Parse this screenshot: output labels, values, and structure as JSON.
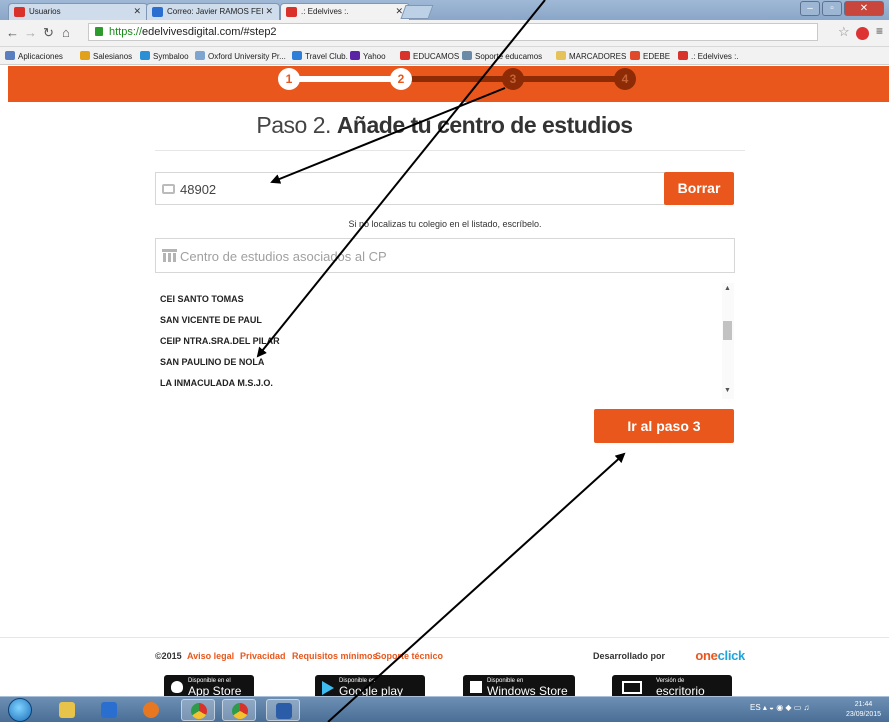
{
  "browser": {
    "tabs": [
      {
        "label": "Usuarios",
        "fav_color": "#d8322a"
      },
      {
        "label": "Correo: Javier RAMOS FEI",
        "fav_color": "#2a6fd0"
      },
      {
        "label": ".: Edelvives :.",
        "fav_color": "#d8322a"
      }
    ],
    "url_scheme": "https://",
    "url_rest": "edelvivesdigital.com/#step2",
    "bookmarks": [
      {
        "label": "Aplicaciones",
        "color": "#5a7fc0"
      },
      {
        "label": "Salesianos",
        "color": "#e2a11a"
      },
      {
        "label": "Symbaloo",
        "color": "#2b8fd6"
      },
      {
        "label": "Oxford University Pr...",
        "color": "#7ea5cf"
      },
      {
        "label": "Travel Club.",
        "color": "#2f7fd8"
      },
      {
        "label": "Yahoo",
        "color": "#5b23a6"
      },
      {
        "label": "EDUCAMOS",
        "color": "#d8322a"
      },
      {
        "label": "Soporte educamos",
        "color": "#6a8aa8"
      },
      {
        "label": "MARCADORES",
        "color": "#e5c25a"
      },
      {
        "label": "EDEBE",
        "color": "#e04a2a"
      },
      {
        "label": ".: Edelvives :.",
        "color": "#d8322a"
      }
    ]
  },
  "steps": {
    "labels": [
      "1",
      "2",
      "3",
      "4"
    ],
    "current": 2,
    "colors": {
      "bar": "#e9571c",
      "dark": "#8c2b06",
      "done": "#ffffff"
    }
  },
  "page": {
    "title_prefix": "Paso 2. ",
    "title_bold": "Añade tu centro de estudios",
    "postal_code_value": "48902",
    "clear_button": "Borrar",
    "hint": "Si no localizas tu colegio en el listado, escríbelo.",
    "school_placeholder": "Centro de estudios asociados al CP",
    "schools": [
      "CEI SANTO TOMAS",
      "SAN VICENTE DE PAUL",
      "CEIP NTRA.SRA.DEL PILAR",
      "SAN PAULINO DE NOLA",
      "LA INMACULADA M.S.J.O."
    ],
    "next_button": "Ir al paso 3"
  },
  "footer": {
    "copyright": "©2015",
    "links": [
      "Aviso legal",
      "Privacidad",
      "Requisitos mínimos",
      "Soporte técnico"
    ],
    "developed_by": "Desarrollado por",
    "brand_a": "one",
    "brand_b": "click",
    "stores": [
      {
        "small": "Disponible en el",
        "big": "App Store"
      },
      {
        "small": "Disponible en",
        "big": "Google play"
      },
      {
        "small": "Disponible en",
        "big": "Windows Store"
      },
      {
        "small": "Versión de",
        "big": "escritorio"
      }
    ]
  },
  "taskbar": {
    "lang": "ES",
    "time": "21:44",
    "date": "23/09/2015"
  }
}
